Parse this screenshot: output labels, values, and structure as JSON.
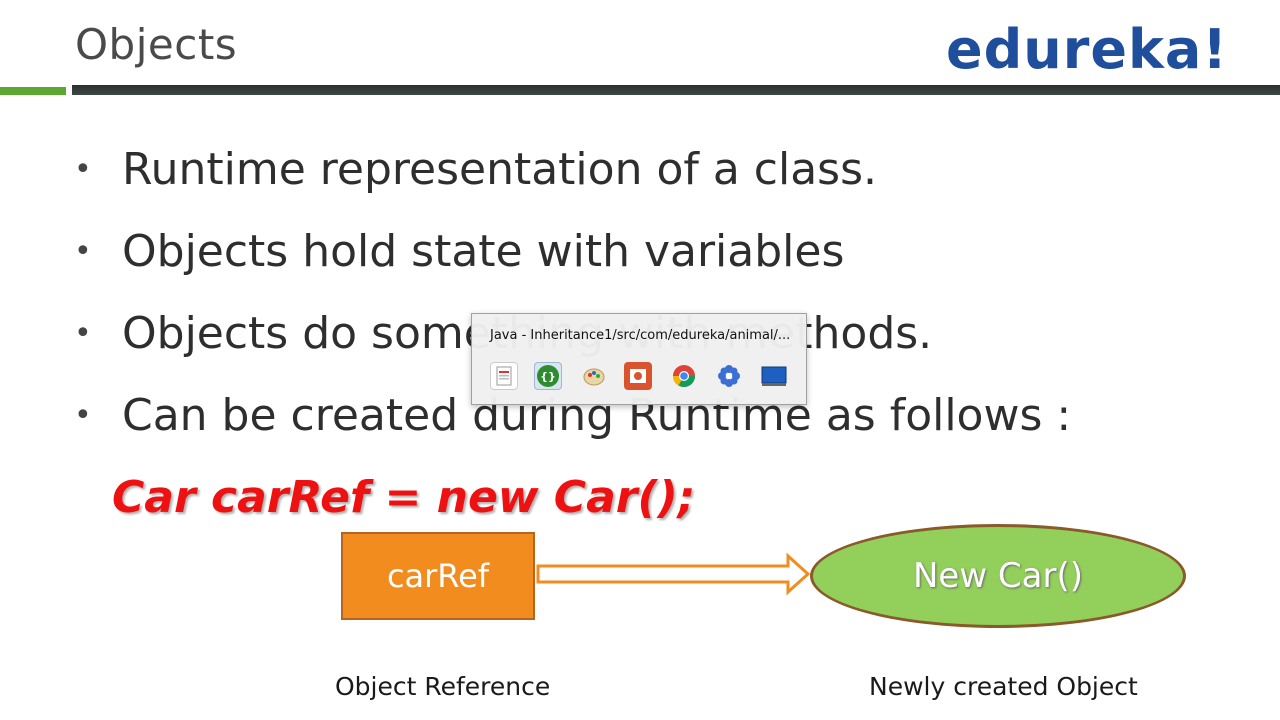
{
  "header": {
    "title": "Objects",
    "logo": "edureka!"
  },
  "bullets": [
    "Runtime representation of a class.",
    "Objects hold state with variables",
    "Objects do something with methods.",
    "Can be created during Runtime as follows :"
  ],
  "bullet_symbol": "•",
  "code": "Car carRef = new Car();",
  "diagram": {
    "ref_label": "carRef",
    "object_label": "New Car()",
    "caption_left": "Object Reference",
    "caption_right": "Newly created Object"
  },
  "taskbar_popup": {
    "window_title": "Java - Inheritance1/src/com/edureka/animal/...",
    "icons": [
      "pdf-document-icon",
      "eclipse-java-icon",
      "paint-icon",
      "powerpoint-icon",
      "chrome-icon",
      "flower-app-icon",
      "desktop-icon"
    ]
  },
  "colors": {
    "logo": "#1f4e9c",
    "code": "#ee1111",
    "ref_box": "#f28c1f",
    "object_ellipse": "#93cf5b",
    "accent_green": "#5aa832"
  }
}
